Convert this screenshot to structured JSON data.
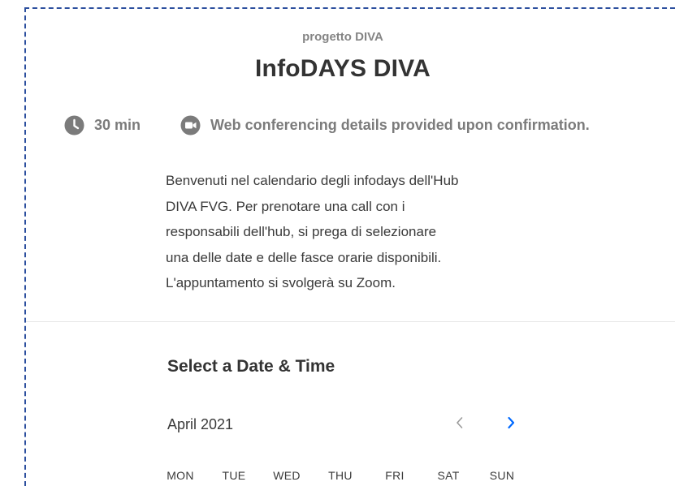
{
  "event": {
    "organizer": "progetto DIVA",
    "title": "InfoDAYS DIVA",
    "duration": "30 min",
    "conferencing": "Web conferencing details provided upon confirmation.",
    "description_lines": [
      "Benvenuti nel calendario degli infodays dell'Hub",
      "DIVA FVG. Per prenotare una call con i",
      "responsabili dell'hub, si prega di selezionare",
      "una delle date e delle fasce orarie disponibili.",
      "L'appuntamento si svolgerà su Zoom."
    ]
  },
  "scheduler": {
    "section_title": "Select a Date & Time",
    "month": "April 2021",
    "prev_icon": "chevron-left-icon",
    "next_icon": "chevron-right-icon",
    "weekdays": [
      "MON",
      "TUE",
      "WED",
      "THU",
      "FRI",
      "SAT",
      "SUN"
    ]
  },
  "colors": {
    "accent": "#0069ff",
    "selection_border": "#2c4f9e",
    "muted_text": "#7b7b7b",
    "icon_gray": "#7b7b7b",
    "disabled_chevron": "#9a9a9a"
  }
}
